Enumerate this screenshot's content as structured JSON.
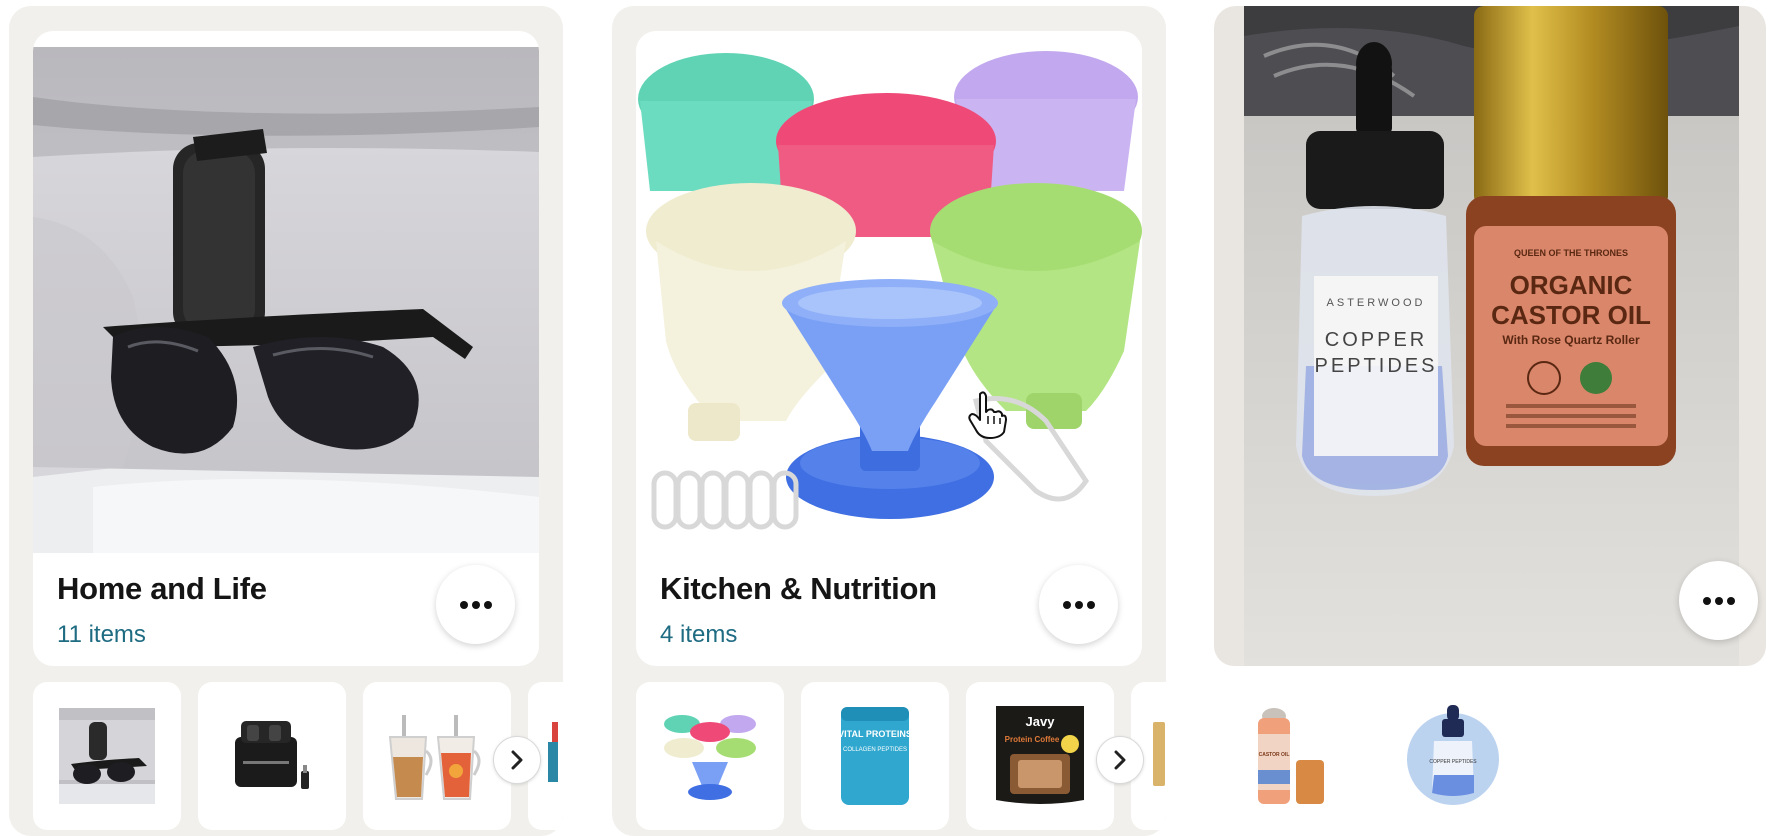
{
  "collections": [
    {
      "title": "Home and Life",
      "count": "11 items",
      "more_label": "More options",
      "next_label": "Next items",
      "thumbnails": [
        "Sunglasses clip",
        "Wireless microphone kit",
        "Tumbler cups",
        "Partial item"
      ]
    },
    {
      "title": "Kitchen & Nutrition",
      "count": "4 items",
      "more_label": "More options",
      "next_label": "Next items",
      "thumbnails": [
        "Silicone funnels",
        "Collagen peptides",
        "Protein coffee",
        "Partial item"
      ]
    },
    {
      "title": "",
      "count": "",
      "more_label": "More options",
      "thumbnails": [
        "Castor oil roller",
        "Copper peptides serum"
      ],
      "hero_text": {
        "brand_left": "ASTERWOOD",
        "product_left_line1": "COPPER",
        "product_left_line2": "PEPTIDES",
        "brand_right": "QUEEN OF THE THRONES",
        "product_right_line1": "ORGANIC",
        "product_right_line2": "CASTOR OIL",
        "product_right_line3": "With Rose Quartz Roller"
      }
    }
  ],
  "thumb_labels": {
    "vital_proteins": "VITAL PROTEINS",
    "collagen": "COLLAGEN PEPTIDES",
    "javy": "Javy",
    "protein_coffee": "Protein Coffee",
    "copper": "COPPER PEPTIDES",
    "castor": "CASTOR OIL"
  },
  "colors": {
    "collection_bg": "#f1f0ec",
    "count_text": "#1e6b82",
    "title_text": "#151515"
  }
}
